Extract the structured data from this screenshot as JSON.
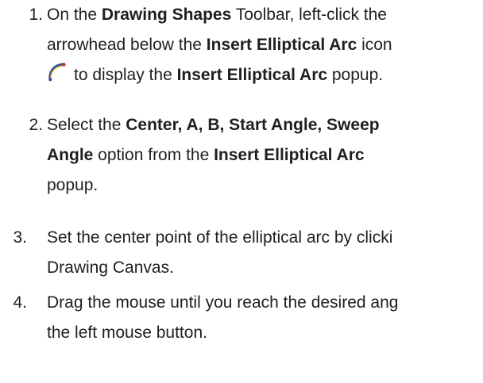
{
  "steps": [
    {
      "number": "1.",
      "line1_a": "On the ",
      "line1_b": "Drawing Shapes",
      "line1_c": " Toolbar, left-click the",
      "line2_a": "arrowhead below the ",
      "line2_b": "Insert Elliptical Arc",
      "line2_c": " icon",
      "line3_a": "to display the ",
      "line3_b": "Insert Elliptical Arc",
      "line3_c": " popup."
    },
    {
      "number": "2.",
      "line1_a": "Select the ",
      "line1_b": "Center, A, B, Start Angle, Sweep",
      "line2_a": "Angle",
      "line2_b": " option from the ",
      "line2_c": "Insert Elliptical Arc",
      "line3_a": "popup."
    },
    {
      "number": "3.",
      "line1": "Set the center point of the elliptical arc by clicki",
      "line2": "Drawing Canvas."
    },
    {
      "number": "4.",
      "line1": "Drag the mouse until you reach the desired ang",
      "line2": "the left mouse button."
    }
  ],
  "icons": {
    "arc_icon": "insert-elliptical-arc-icon"
  }
}
